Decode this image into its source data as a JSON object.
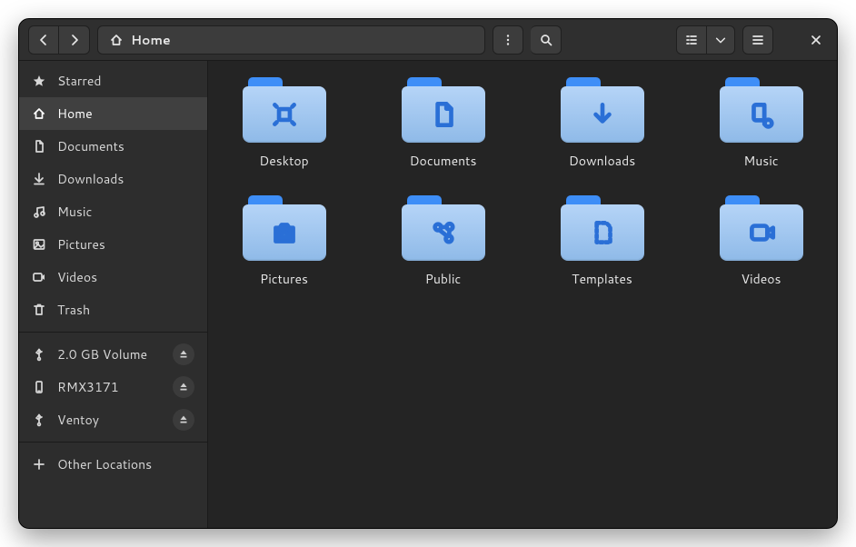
{
  "path": {
    "label": "Home",
    "icon": "home-icon"
  },
  "sidebar": {
    "places": [
      {
        "id": "starred",
        "label": "Starred",
        "icon": "star-icon",
        "selected": false
      },
      {
        "id": "home",
        "label": "Home",
        "icon": "home-icon",
        "selected": true
      },
      {
        "id": "documents",
        "label": "Documents",
        "icon": "document-icon",
        "selected": false
      },
      {
        "id": "downloads",
        "label": "Downloads",
        "icon": "download-icon",
        "selected": false
      },
      {
        "id": "music",
        "label": "Music",
        "icon": "music-icon",
        "selected": false
      },
      {
        "id": "pictures",
        "label": "Pictures",
        "icon": "image-icon",
        "selected": false
      },
      {
        "id": "videos",
        "label": "Videos",
        "icon": "video-icon",
        "selected": false
      },
      {
        "id": "trash",
        "label": "Trash",
        "icon": "trash-icon",
        "selected": false
      }
    ],
    "devices": [
      {
        "id": "vol-2gb",
        "label": "2.0 GB Volume",
        "icon": "usb-icon",
        "ejectable": true
      },
      {
        "id": "rmx3171",
        "label": "RMX3171",
        "icon": "phone-icon",
        "ejectable": true
      },
      {
        "id": "ventoy",
        "label": "Ventoy",
        "icon": "usb-icon",
        "ejectable": true
      }
    ],
    "other": {
      "label": "Other Locations",
      "icon": "plus-icon"
    }
  },
  "folders": [
    {
      "id": "desktop",
      "label": "Desktop",
      "glyph": "desktop-glyph"
    },
    {
      "id": "documents",
      "label": "Documents",
      "glyph": "document-glyph"
    },
    {
      "id": "downloads",
      "label": "Downloads",
      "glyph": "download-glyph"
    },
    {
      "id": "music",
      "label": "Music",
      "glyph": "music-glyph"
    },
    {
      "id": "pictures",
      "label": "Pictures",
      "glyph": "pictures-glyph"
    },
    {
      "id": "public",
      "label": "Public",
      "glyph": "public-glyph"
    },
    {
      "id": "templates",
      "label": "Templates",
      "glyph": "templates-glyph"
    },
    {
      "id": "videos",
      "label": "Videos",
      "glyph": "videos-glyph"
    }
  ],
  "colors": {
    "folder_tab": "#3e8ef7",
    "folder_body_top": "#b5d4f7",
    "folder_body_bottom": "#8fbae8",
    "folder_glyph": "#2a6fd6"
  }
}
